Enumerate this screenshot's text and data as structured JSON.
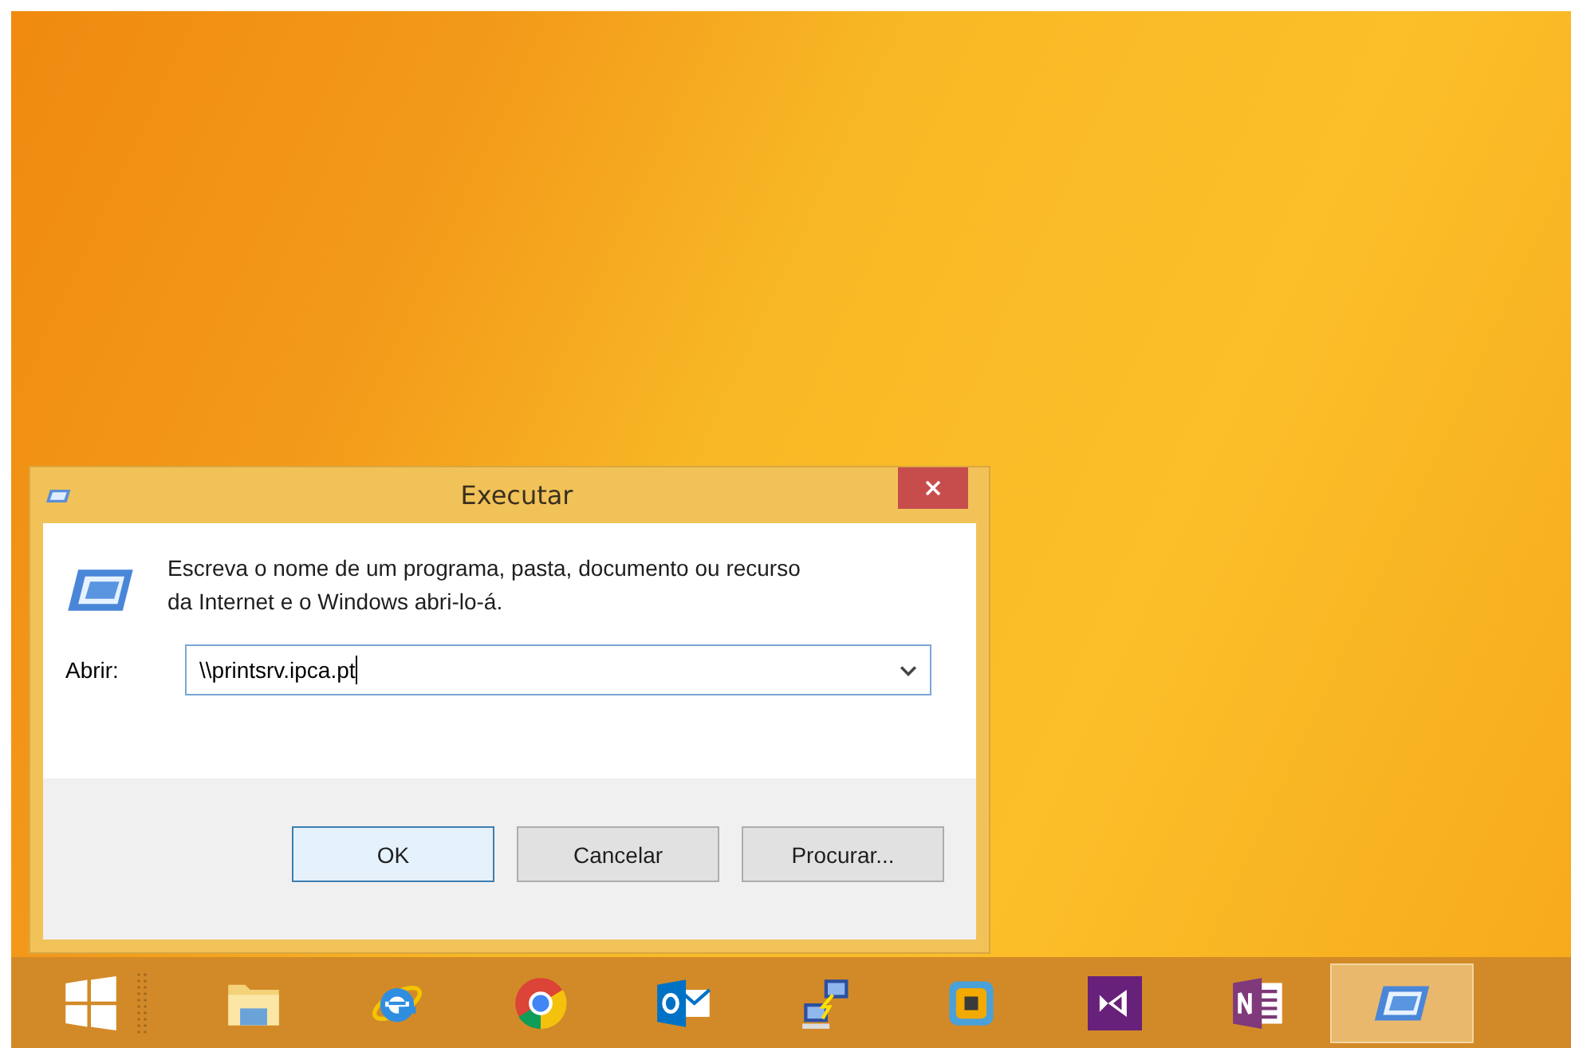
{
  "dialog": {
    "title": "Executar",
    "description": "Escreva o nome de um programa, pasta, documento ou recurso da Internet e o Windows abri-lo-á.",
    "open_label": "Abrir:",
    "open_value": "\\\\printsrv.ipca.pt",
    "buttons": [
      {
        "label": "OK",
        "selected": true
      },
      {
        "label": "Cancelar",
        "selected": false
      },
      {
        "label": "Procurar...",
        "selected": false
      }
    ]
  },
  "taskbar": {
    "items": [
      {
        "kind": "start",
        "selected": false
      },
      {
        "kind": "explorer",
        "selected": false
      },
      {
        "kind": "ie",
        "selected": false
      },
      {
        "kind": "chrome",
        "selected": false
      },
      {
        "kind": "outlook",
        "selected": false
      },
      {
        "kind": "network",
        "selected": false
      },
      {
        "kind": "vm",
        "selected": false
      },
      {
        "kind": "studio",
        "selected": false
      },
      {
        "kind": "onenote",
        "selected": false
      },
      {
        "kind": "run",
        "selected": true
      }
    ]
  }
}
